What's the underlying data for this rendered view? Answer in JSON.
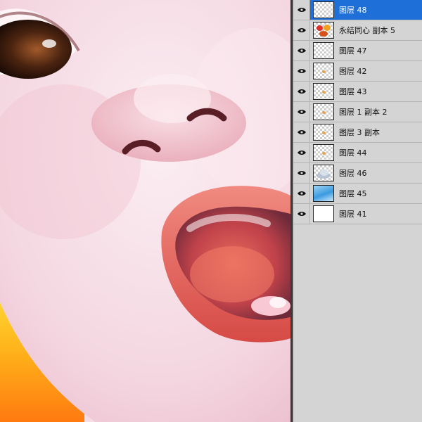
{
  "layers_panel": {
    "layers": [
      {
        "name": "图层 48",
        "visible": true,
        "selected": true,
        "thumbnail": "transparent"
      },
      {
        "name": "永结同心 副本 5",
        "visible": true,
        "selected": false,
        "thumbnail": "ornament"
      },
      {
        "name": "图层 47",
        "visible": true,
        "selected": false,
        "thumbnail": "transparent"
      },
      {
        "name": "图层 42",
        "visible": true,
        "selected": false,
        "thumbnail": "transparent-dot"
      },
      {
        "name": "图层 43",
        "visible": true,
        "selected": false,
        "thumbnail": "transparent-dot"
      },
      {
        "name": "图层 1 副本 2",
        "visible": true,
        "selected": false,
        "thumbnail": "transparent-dot"
      },
      {
        "name": "图层 3 副本",
        "visible": true,
        "selected": false,
        "thumbnail": "transparent-dot"
      },
      {
        "name": "图层 44",
        "visible": true,
        "selected": false,
        "thumbnail": "transparent-dot"
      },
      {
        "name": "图层 46",
        "visible": true,
        "selected": false,
        "thumbnail": "cloud"
      },
      {
        "name": "图层 45",
        "visible": true,
        "selected": false,
        "thumbnail": "sky"
      },
      {
        "name": "图层 41",
        "visible": true,
        "selected": false,
        "thumbnail": "white"
      }
    ]
  },
  "colors": {
    "selection": "#1e6fd8",
    "panel_bg": "#d4d4d4",
    "skin": "#f6dde5",
    "lip": "#e0584f"
  }
}
